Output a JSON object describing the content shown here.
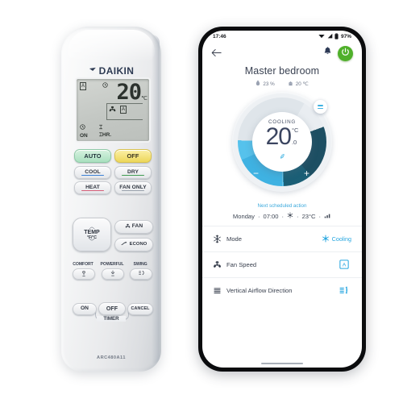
{
  "product": {
    "brand": "DAIKIN",
    "model_code": "ARC480A11"
  },
  "remote": {
    "lcd": {
      "temperature": "20",
      "unit": "℃",
      "auto_badge": "A",
      "clock_icon": "clock-icon",
      "fan_icon": "fan-icon",
      "fan_auto_badge": "A",
      "timer_on_label": "ON",
      "timer_hour_label": "HR.",
      "timer_on_icon": "timer-icon",
      "timer_hour_value": "⌶"
    },
    "buttons": [
      {
        "id": "auto",
        "label": "AUTO",
        "style": "green"
      },
      {
        "id": "off",
        "label": "OFF",
        "style": "yellow"
      },
      {
        "id": "cool",
        "label": "COOL",
        "accent": "#3a7fd5"
      },
      {
        "id": "dry",
        "label": "DRY",
        "accent": "#3f9b52"
      },
      {
        "id": "heat",
        "label": "HEAT",
        "accent": "#d6607a"
      },
      {
        "id": "fan-only",
        "label": "FAN ONLY",
        "accent": "#9aa2ad"
      }
    ],
    "temp_key": {
      "label": "TEMP",
      "units": "°F/°C",
      "up_icon": "chevron-up-icon",
      "down_icon": "chevron-down-icon"
    },
    "side_keys": [
      {
        "id": "fan",
        "label": "FAN",
        "icon": "fan-icon"
      },
      {
        "id": "econo",
        "label": "ECONO",
        "icon": "econo-icon"
      }
    ],
    "feature_keys": [
      {
        "id": "comfort",
        "label": "COMFORT",
        "icon": "comfort-icon"
      },
      {
        "id": "powerful",
        "label": "POWERFUL",
        "icon": "powerful-icon"
      },
      {
        "id": "swing",
        "label": "SWING",
        "icon": "swing-icon"
      }
    ],
    "timer_keys": [
      {
        "id": "on",
        "label": "ON"
      },
      {
        "id": "off",
        "label": "OFF"
      },
      {
        "id": "cancel",
        "label": "CANCEL"
      }
    ],
    "timer_group_label": "TIMER"
  },
  "phone": {
    "status_bar": {
      "time": "17:46",
      "battery_percent": "97%",
      "icons": [
        "wifi-icon",
        "signal-icon",
        "battery-icon"
      ]
    },
    "app_bar": {
      "back_icon": "back-arrow-icon",
      "notification_icon": "bell-icon",
      "power_icon": "power-icon",
      "power_color": "#4fb02a"
    },
    "header": {
      "room_name": "Master bedroom",
      "humidity": "23 %",
      "humidity_icon": "humidity-icon",
      "outdoor_temp": "20 ℃",
      "outdoor_icon": "home-temp-icon"
    },
    "dial": {
      "mode_caption": "COOLING",
      "temperature": "20",
      "unit": "°C",
      "decimal": ".0",
      "eco_icon": "leaf-icon",
      "minus_label": "−",
      "plus_label": "+",
      "handle_icon": "drag-handle-icon",
      "accent_color": "#3fb2e2",
      "track_dark": "#1b5f76",
      "track_light": "#dfe5ea"
    },
    "schedule": {
      "heading": "Next scheduled action",
      "day": "Monday",
      "time": "07:00",
      "mode_icon": "snowflake-icon",
      "temperature": "23°C",
      "fan_icon": "fan-level-icon",
      "separator": "·"
    },
    "settings_rows": [
      {
        "id": "mode",
        "icon": "snowflake-icon",
        "label": "Mode",
        "value": "Cooling",
        "value_icon": "snowflake-icon"
      },
      {
        "id": "fan-speed",
        "icon": "fan-icon",
        "label": "Fan Speed",
        "value": "",
        "value_icon": "fan-auto-icon"
      },
      {
        "id": "vertical-airflow",
        "icon": "louver-icon",
        "label": "Vertical Airflow Direction",
        "value": "",
        "value_icon": "airflow-icon"
      }
    ],
    "home_indicator": "home-indicator"
  }
}
